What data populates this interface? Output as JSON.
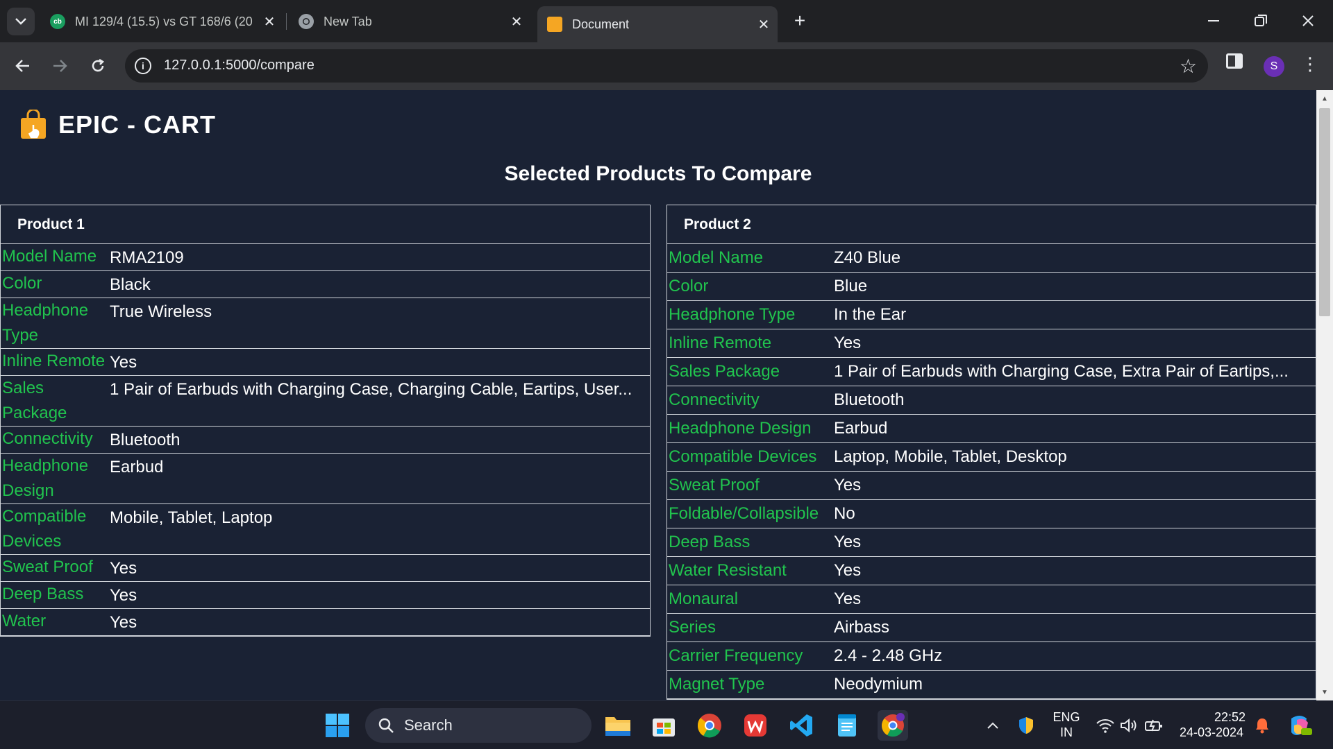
{
  "browser": {
    "tabs": [
      {
        "title": "MI 129/4 (15.5) vs GT 168/6 (20",
        "favicon": "cricbuzz-icon"
      },
      {
        "title": "New Tab",
        "favicon": "chrome-icon"
      },
      {
        "title": "Document",
        "favicon": "shopping-bag-icon",
        "active": true
      }
    ],
    "url": "127.0.0.1:5000/compare",
    "profile_initial": "S"
  },
  "page": {
    "brand": "EPIC - CART",
    "heading": "Selected Products To Compare",
    "accent_color": "#21c44e",
    "products": [
      {
        "header": "Product 1",
        "specs": [
          {
            "key": "Model Name",
            "value": "RMA2109"
          },
          {
            "key": "Color",
            "value": "Black"
          },
          {
            "key": "Headphone Type",
            "value": "True Wireless"
          },
          {
            "key": "Inline Remote",
            "value": "Yes"
          },
          {
            "key": "Sales Package",
            "value": "1 Pair of Earbuds with Charging Case, Charging Cable, Eartips, User..."
          },
          {
            "key": "Connectivity",
            "value": "Bluetooth"
          },
          {
            "key": "Headphone Design",
            "value": "Earbud"
          },
          {
            "key": "Compatible Devices",
            "value": "Mobile, Tablet, Laptop"
          },
          {
            "key": "Sweat Proof",
            "value": "Yes"
          },
          {
            "key": "Deep Bass",
            "value": "Yes"
          },
          {
            "key": "Water",
            "value": "Yes"
          }
        ]
      },
      {
        "header": "Product 2",
        "specs": [
          {
            "key": "Model Name",
            "value": "Z40 Blue"
          },
          {
            "key": "Color",
            "value": "Blue"
          },
          {
            "key": "Headphone Type",
            "value": "In the Ear"
          },
          {
            "key": "Inline Remote",
            "value": "Yes"
          },
          {
            "key": "Sales Package",
            "value": "1 Pair of Earbuds with Charging Case, Extra Pair of Eartips,..."
          },
          {
            "key": "Connectivity",
            "value": "Bluetooth"
          },
          {
            "key": "Headphone Design",
            "value": "Earbud"
          },
          {
            "key": "Compatible Devices",
            "value": "Laptop, Mobile, Tablet, Desktop"
          },
          {
            "key": "Sweat Proof",
            "value": "Yes"
          },
          {
            "key": "Foldable/Collapsible",
            "value": "No"
          },
          {
            "key": "Deep Bass",
            "value": "Yes"
          },
          {
            "key": "Water Resistant",
            "value": "Yes"
          },
          {
            "key": "Monaural",
            "value": "Yes"
          },
          {
            "key": "Series",
            "value": "Airbass"
          },
          {
            "key": "Carrier Frequency",
            "value": "2.4 - 2.48 GHz"
          },
          {
            "key": "Magnet Type",
            "value": "Neodymium"
          }
        ]
      }
    ]
  },
  "taskbar": {
    "search_placeholder": "Search",
    "language": "ENG",
    "region": "IN",
    "time": "22:52",
    "date": "24-03-2024"
  }
}
